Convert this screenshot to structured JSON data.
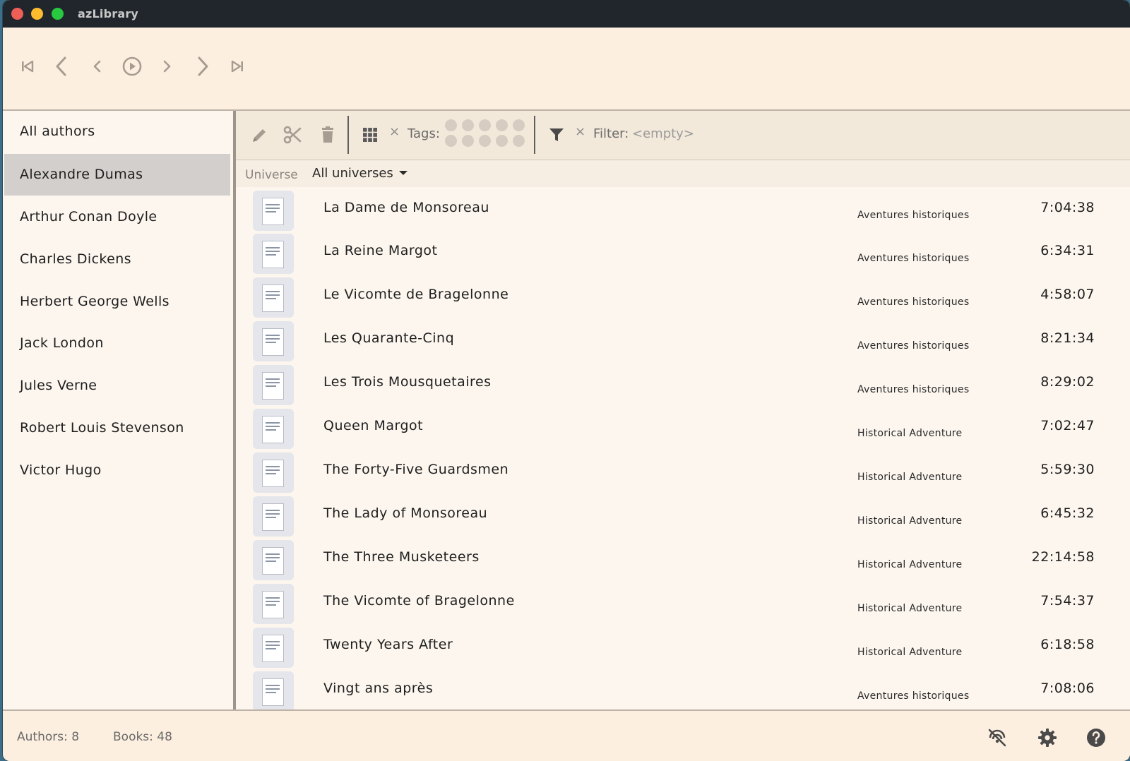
{
  "window": {
    "title": "azLibrary"
  },
  "player": {
    "buttons": [
      "skip-to-start-icon",
      "previous-icon",
      "rewind-icon",
      "play-icon",
      "forward-icon",
      "next-icon",
      "skip-to-end-icon"
    ]
  },
  "sidebar": {
    "authors": [
      {
        "name": "All authors",
        "selected": false
      },
      {
        "name": "Alexandre Dumas",
        "selected": true
      },
      {
        "name": "Arthur Conan Doyle",
        "selected": false
      },
      {
        "name": "Charles Dickens",
        "selected": false
      },
      {
        "name": "Herbert George Wells",
        "selected": false
      },
      {
        "name": "Jack London",
        "selected": false
      },
      {
        "name": "Jules Verne",
        "selected": false
      },
      {
        "name": "Robert Louis Stevenson",
        "selected": false
      },
      {
        "name": "Victor Hugo",
        "selected": false
      }
    ]
  },
  "toolbar": {
    "tags_label": "Tags:",
    "filter_label": "Filter:",
    "filter_value": "<empty>",
    "clear_symbol": "×"
  },
  "universe": {
    "label": "Universe",
    "selected": "All universes"
  },
  "books": [
    {
      "title": "La Dame de Monsoreau",
      "universe": "Aventures historiques",
      "duration": "7:04:38"
    },
    {
      "title": "La Reine Margot",
      "universe": "Aventures historiques",
      "duration": "6:34:31"
    },
    {
      "title": "Le Vicomte de Bragelonne",
      "universe": "Aventures historiques",
      "duration": "4:58:07"
    },
    {
      "title": "Les Quarante-Cinq",
      "universe": "Aventures historiques",
      "duration": "8:21:34"
    },
    {
      "title": "Les Trois Mousquetaires",
      "universe": "Aventures historiques",
      "duration": "8:29:02"
    },
    {
      "title": "Queen Margot",
      "universe": "Historical Adventure",
      "duration": "7:02:47"
    },
    {
      "title": "The Forty-Five Guardsmen",
      "universe": "Historical Adventure",
      "duration": "5:59:30"
    },
    {
      "title": "The Lady of Monsoreau",
      "universe": "Historical Adventure",
      "duration": "6:45:32"
    },
    {
      "title": "The Three Musketeers",
      "universe": "Historical Adventure",
      "duration": "22:14:58"
    },
    {
      "title": "The Vicomte of Bragelonne",
      "universe": "Historical Adventure",
      "duration": "7:54:37"
    },
    {
      "title": "Twenty Years After",
      "universe": "Historical Adventure",
      "duration": "6:18:58"
    },
    {
      "title": "Vingt ans après",
      "universe": "Aventures historiques",
      "duration": "7:08:06"
    }
  ],
  "status": {
    "authors": "Authors: 8",
    "books": "Books: 48"
  },
  "colors": {
    "background": "#fcf6ee",
    "selected": "#d3cfcc",
    "toolbar": "#f3e9db",
    "icon": "#a69c92"
  }
}
